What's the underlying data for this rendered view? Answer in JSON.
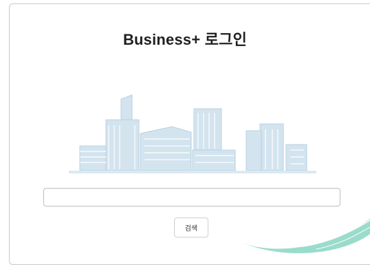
{
  "login": {
    "title": "Business+ 로그인",
    "search_input": {
      "value": "",
      "placeholder": ""
    },
    "search_button_label": "검색"
  },
  "illustration": {
    "icon": "city-buildings-illustration",
    "color": "#c7dcea"
  },
  "decoration": {
    "icon": "teal-swoosh",
    "color": "#8fd3c3"
  }
}
